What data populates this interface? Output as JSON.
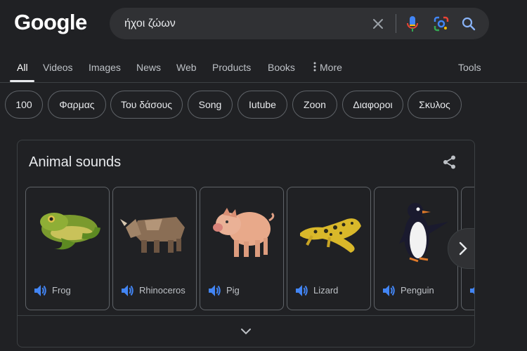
{
  "logo": "Google",
  "search": {
    "query": "ήχοι ζώων"
  },
  "tabs": [
    {
      "label": "All",
      "active": true
    },
    {
      "label": "Videos"
    },
    {
      "label": "Images"
    },
    {
      "label": "News"
    },
    {
      "label": "Web"
    },
    {
      "label": "Products"
    },
    {
      "label": "Books"
    },
    {
      "label": "More"
    }
  ],
  "tools": "Tools",
  "chips": [
    "100",
    "Φαρμας",
    "Του δάσους",
    "Song",
    "Iutube",
    "Zoon",
    "Διαφοροι",
    "Σκυλος"
  ],
  "card": {
    "title": "Animal sounds",
    "animals": [
      {
        "name": "Frog",
        "icon": "frog-image"
      },
      {
        "name": "Rhinoceros",
        "icon": "rhinoceros-image"
      },
      {
        "name": "Pig",
        "icon": "pig-image"
      },
      {
        "name": "Lizard",
        "icon": "lizard-image"
      },
      {
        "name": "Penguin",
        "icon": "penguin-image"
      }
    ]
  },
  "colors": {
    "background": "#202124",
    "accent_blue": "#8ab4f8",
    "speaker_blue": "#4285f4"
  }
}
